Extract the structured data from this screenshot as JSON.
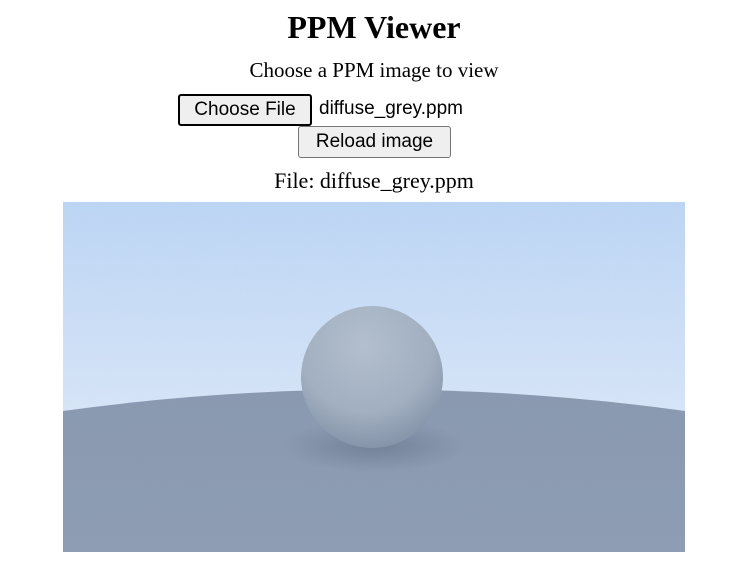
{
  "page": {
    "title": "PPM Viewer",
    "subtitle": "Choose a PPM image to view"
  },
  "file_input": {
    "button_label": "Choose File",
    "selected_file": "diffuse_grey.ppm"
  },
  "reload": {
    "button_label": "Reload image"
  },
  "current_file": {
    "label": "File: diffuse_grey.ppm"
  },
  "image": {
    "content": "rendered grey diffuse sphere resting on a large grey ground sphere under a light blue sky",
    "colors": {
      "sky_top": "#bcd6f6",
      "sky_bottom": "#e9f0fb",
      "ground": "#8898b0",
      "ground_dark": "#7f8fa8",
      "sphere_light": "#b2bfce",
      "sphere_dark": "#7d8ca3"
    }
  }
}
